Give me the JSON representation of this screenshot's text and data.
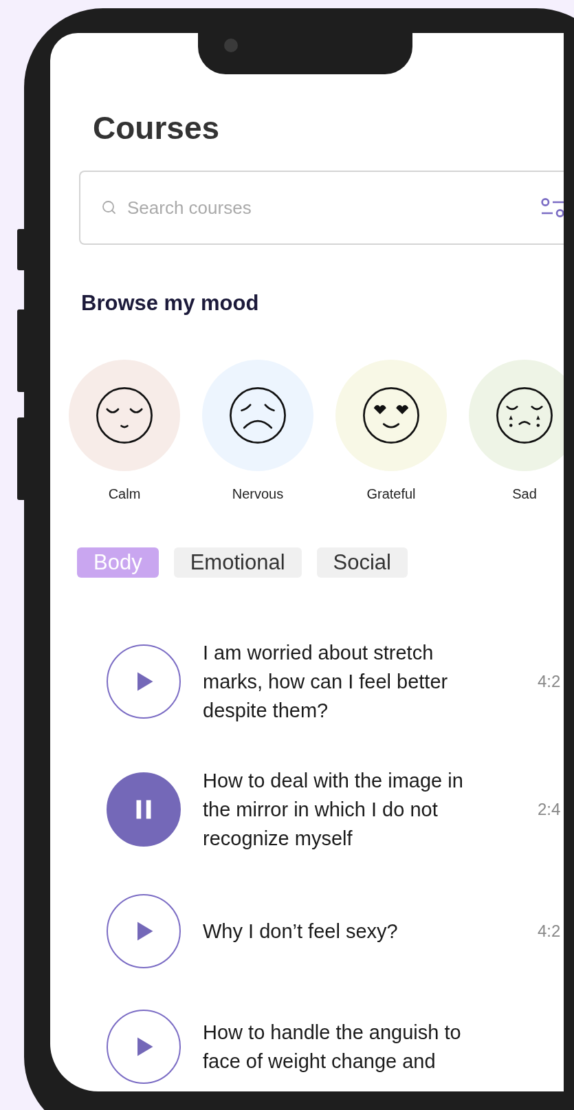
{
  "screen_title": "Courses",
  "search": {
    "placeholder": "Search courses"
  },
  "mood_section": {
    "title": "Browse my mood",
    "moods": [
      {
        "label": "Calm",
        "kind": "calm",
        "color": "#f7ece8"
      },
      {
        "label": "Nervous",
        "kind": "nervous",
        "color": "#edf5fe"
      },
      {
        "label": "Grateful",
        "kind": "grateful",
        "color": "#f8f8e6"
      },
      {
        "label": "Sad",
        "kind": "sad",
        "color": "#eef4e6"
      }
    ]
  },
  "tabs": [
    {
      "label": "Body",
      "selected": true
    },
    {
      "label": "Emotional",
      "selected": false
    },
    {
      "label": "Social",
      "selected": false
    }
  ],
  "courses": [
    {
      "title": "I am worried about stretch marks, how can I feel better despite them?",
      "duration": "4:2",
      "playing": false
    },
    {
      "title": "How to deal with the image in the mirror in which I do not recognize myself",
      "duration": "2:4",
      "playing": true
    },
    {
      "title": "Why I don’t feel sexy?",
      "duration": "4:2",
      "playing": false
    },
    {
      "title": "How to handle the anguish to face of weight change and",
      "playing": false
    }
  ]
}
